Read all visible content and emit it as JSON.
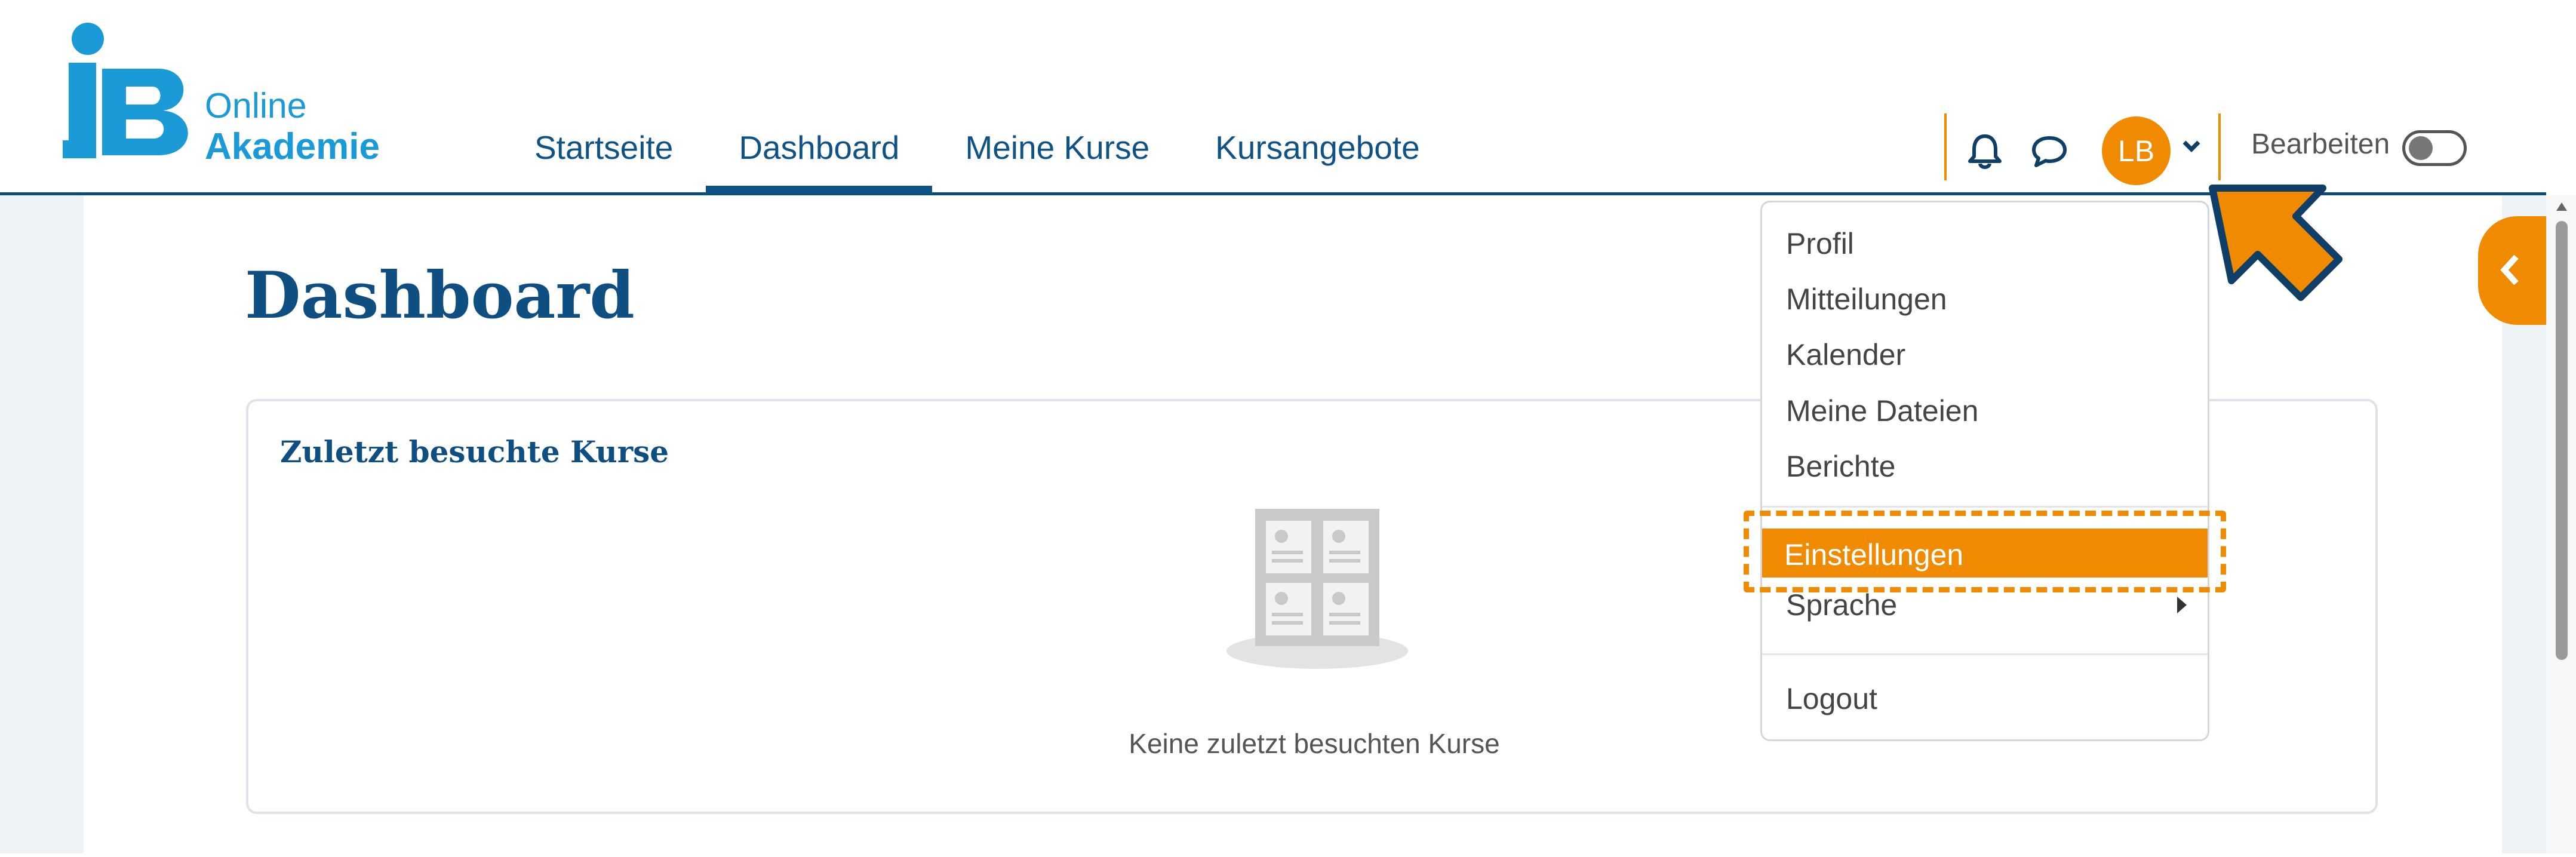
{
  "brand": {
    "mark": "iB",
    "line1": "Online",
    "line2": "Akademie"
  },
  "nav": {
    "items": [
      {
        "label": "Startseite",
        "active": false
      },
      {
        "label": "Dashboard",
        "active": true
      },
      {
        "label": "Meine Kurse",
        "active": false
      },
      {
        "label": "Kursangebote",
        "active": false
      }
    ]
  },
  "user": {
    "initials": "LB"
  },
  "edit_mode": {
    "label": "Bearbeiten",
    "enabled": false
  },
  "page": {
    "title": "Dashboard"
  },
  "recent_courses": {
    "title": "Zuletzt besuchte Kurse",
    "empty_message": "Keine zuletzt besuchten Kurse"
  },
  "user_menu": {
    "items": [
      {
        "label": "Profil"
      },
      {
        "label": "Mitteilungen"
      },
      {
        "label": "Kalender"
      },
      {
        "label": "Meine Dateien"
      },
      {
        "label": "Berichte"
      },
      {
        "label": "Einstellungen",
        "highlighted": true
      },
      {
        "label": "Sprache",
        "has_submenu": true
      },
      {
        "label": "Logout"
      }
    ]
  },
  "colors": {
    "brand_blue": "#0f5286",
    "logo_blue": "#1a9ad6",
    "accent_orange": "#f08a00"
  },
  "icons": [
    "bell-icon",
    "chat-bubble-icon",
    "chevron-down-icon",
    "chevron-left-icon",
    "course-placeholder-icon",
    "arrow-pointer-icon"
  ]
}
